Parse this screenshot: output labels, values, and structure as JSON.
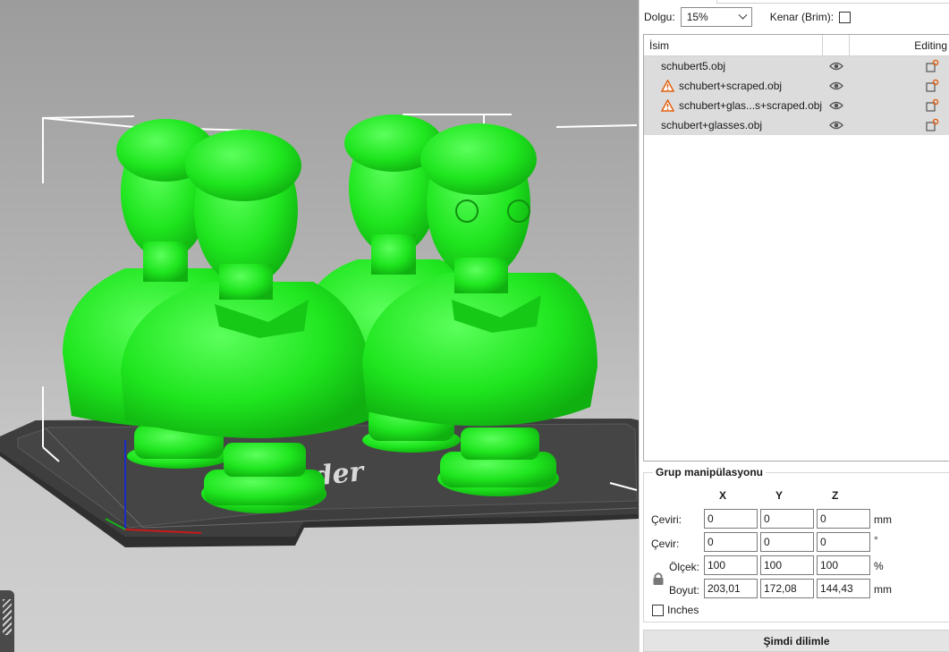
{
  "viewport": {
    "bed_text": "nder",
    "model_color": "#22ee22"
  },
  "settings": {
    "fill_label": "Dolgu:",
    "fill_value": "15%",
    "brim_label": "Kenar (Brim):"
  },
  "object_list": {
    "header_name": "İsim",
    "header_editing": "Editing",
    "items": [
      {
        "name": "schubert5.obj",
        "warning": false
      },
      {
        "name": "schubert+scraped.obj",
        "warning": true
      },
      {
        "name": "schubert+glas...s+scraped.obj",
        "warning": true
      },
      {
        "name": "schubert+glasses.obj",
        "warning": false
      }
    ]
  },
  "group": {
    "title": "Grup manipülasyonu",
    "axes": [
      "X",
      "Y",
      "Z"
    ],
    "rows": [
      {
        "label": "Çeviri:",
        "values": [
          "0",
          "0",
          "0"
        ],
        "unit": "mm"
      },
      {
        "label": "Çevir:",
        "values": [
          "0",
          "0",
          "0"
        ],
        "unit": "°"
      },
      {
        "label": "Ölçek:",
        "values": [
          "100",
          "100",
          "100"
        ],
        "unit": "%"
      },
      {
        "label": "Boyut:",
        "values": [
          "203,01",
          "172,08",
          "144,43"
        ],
        "unit": "mm"
      }
    ],
    "inches_label": "Inches"
  },
  "slice_button": "Şimdi dilimle"
}
